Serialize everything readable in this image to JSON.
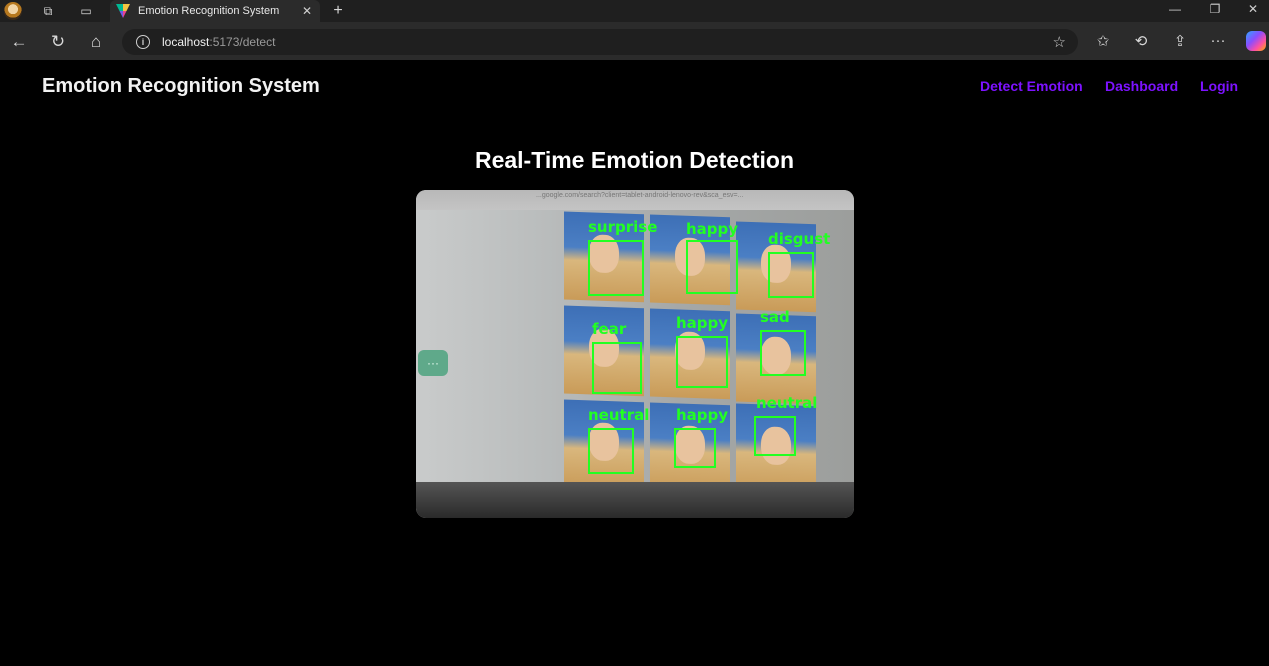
{
  "browser": {
    "tab_title": "Emotion Recognition System",
    "url_host": "localhost",
    "url_path": ":5173/detect",
    "info_icon": "i"
  },
  "header": {
    "brand": "Emotion Recognition System",
    "nav": [
      "Detect Emotion",
      "Dashboard",
      "Login"
    ],
    "nav_color": "#7d12ff"
  },
  "main": {
    "heading": "Real-Time Emotion Detection",
    "feed_url_text": "...google.com/search?client=tablet-android-lenovo-rev&sca_esv=...",
    "detections": [
      "surprise",
      "happy",
      "disgust",
      "fear",
      "happy",
      "sad",
      "neutral",
      "happy",
      "neutral"
    ],
    "box_color": "#22ff22",
    "options_label": "···"
  }
}
